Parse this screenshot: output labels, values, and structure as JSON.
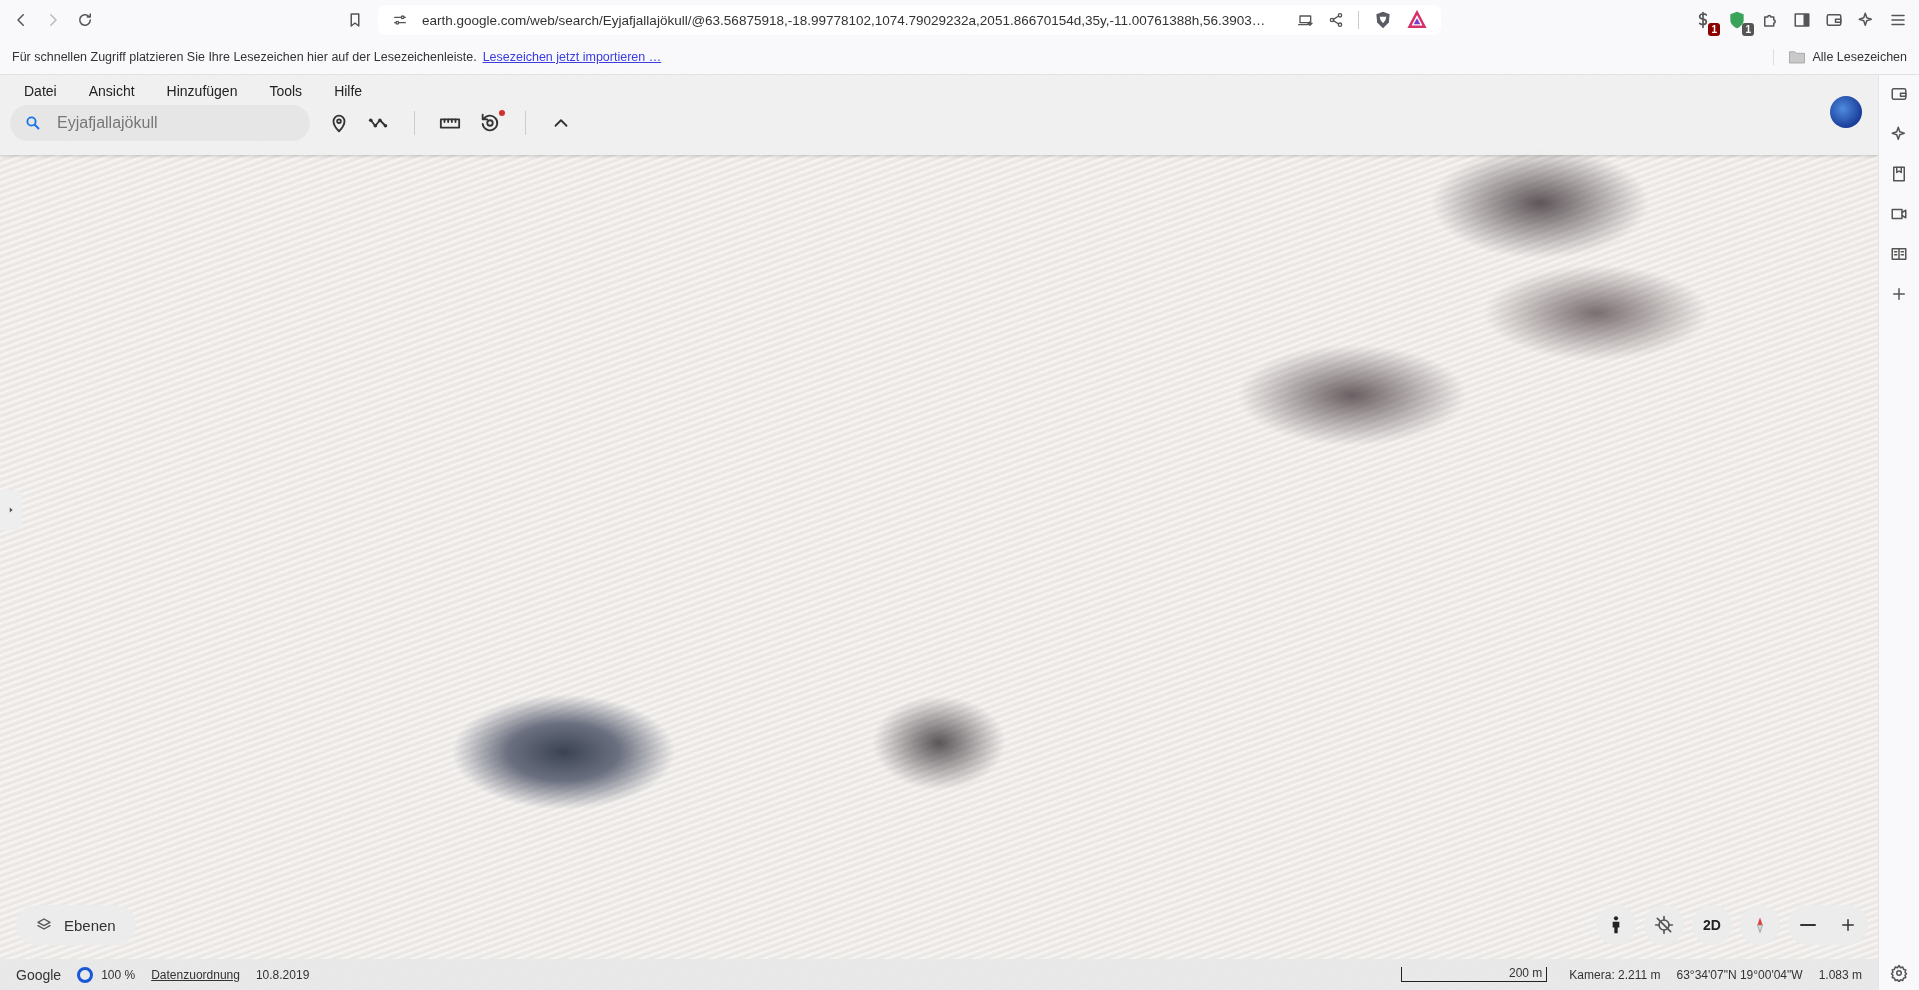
{
  "browser": {
    "url": "earth.google.com/web/search/Eyjafjallajökull/@63.56875918,-18.99778102,1074.79029232a,2051.86670154d,35y,-11.00761388h,56.3903…",
    "extension_badges": [
      {
        "count": "1",
        "color": "#8b0000"
      },
      {
        "count": "1",
        "color": "#555555"
      }
    ],
    "bookmarks_hint": "Für schnellen Zugriff platzieren Sie Ihre Lesezeichen hier auf der Lesezeichenleiste.",
    "bookmarks_import_link": "Lesezeichen jetzt importieren …",
    "all_bookmarks": "Alle Lesezeichen"
  },
  "earth": {
    "menu": [
      "Datei",
      "Ansicht",
      "Hinzufügen",
      "Tools",
      "Hilfe"
    ],
    "search": {
      "placeholder": "Eyjafjallajökull"
    },
    "tools": [
      {
        "kind": "pin",
        "unread": false
      },
      {
        "kind": "path",
        "unread": false
      },
      {
        "kind": "ruler",
        "unread": false
      },
      {
        "kind": "history",
        "unread": true
      },
      {
        "kind": "collapse",
        "unread": false
      }
    ],
    "layers_button": "Ebenen",
    "mode_button": "2D",
    "status_bar": {
      "brand": "Google",
      "loading": "100 %",
      "attribution_link": "Datenzuordnung",
      "date": "10.8.2019",
      "scale": "200 m",
      "camera": "Kamera: 2.211 m",
      "coordinates": "63°34'07\"N 19°00'04\"W",
      "elevation": "1.083 m"
    }
  }
}
